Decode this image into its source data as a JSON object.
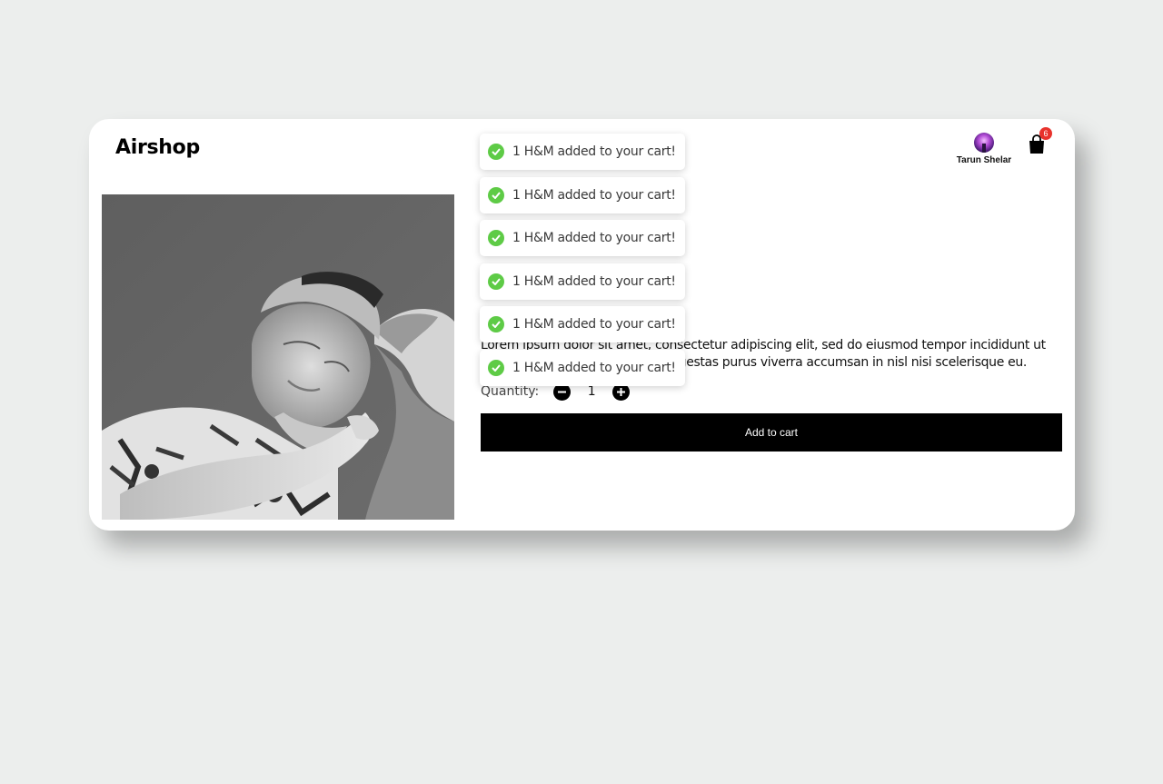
{
  "header": {
    "brand": "Airshop",
    "user_name": "Tarun Shelar",
    "cart_count": "6"
  },
  "product": {
    "title_fragment": "",
    "description": "Lorem ipsum dolor sit amet, consectetur adipiscing elit, sed do eiusmod tempor incididunt ut labore et dolore magna aliqua. Egestas purus viverra accumsan in nisl nisi scelerisque eu.",
    "quantity_label": "Quantity:",
    "quantity_value": "1",
    "add_to_cart_label": "Add to cart"
  },
  "toasts": [
    {
      "message": "1 H&M added to your cart!"
    },
    {
      "message": "1 H&M added to your cart!"
    },
    {
      "message": "1 H&M added to your cart!"
    },
    {
      "message": "1 H&M added to your cart!"
    },
    {
      "message": "1 H&M added to your cart!"
    },
    {
      "message": "1 H&M added to your cart!"
    }
  ],
  "colors": {
    "page_background": "#eceeed",
    "card_background": "#ffffff",
    "button_background": "#000000",
    "toast_success": "#5ecb46",
    "cart_badge": "#e8322c"
  },
  "icons": {
    "cart": "shopping-bag-icon",
    "toast": "check-circle-icon",
    "decrement": "minus-circle-icon",
    "increment": "plus-circle-icon"
  }
}
